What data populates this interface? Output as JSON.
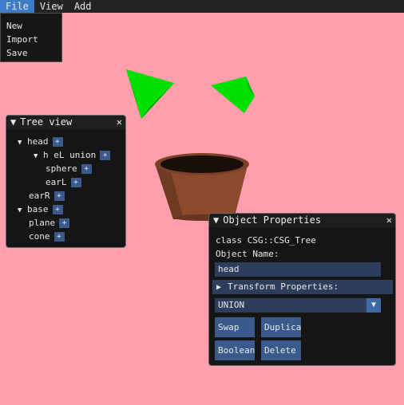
{
  "menubar": {
    "items": [
      "File",
      "View",
      "Add"
    ],
    "file_menu": [
      "New",
      "Import",
      "Save"
    ]
  },
  "tree_view": {
    "title": "Tree view",
    "nodes": [
      {
        "label": "head",
        "expanded": true
      },
      {
        "label": "h eL union",
        "expanded": true
      },
      {
        "label": "sphere"
      },
      {
        "label": "earL"
      },
      {
        "label": "earR"
      },
      {
        "label": "base",
        "expanded": true
      },
      {
        "label": "plane"
      },
      {
        "label": "cone"
      }
    ],
    "plus_label": "+",
    "expand_glyph": "▼",
    "close_glyph": "✕"
  },
  "object_properties": {
    "title": "Object Properties",
    "class_line": "class CSG::CSG_Tree",
    "object_name_label": "Object Name:",
    "object_name_value": "head",
    "transform_header": "Transform Properties:",
    "operation_value": "UNION",
    "buttons": {
      "swap": "Swap",
      "duplicate": "Duplicate",
      "boolean": "Boolean",
      "delete": "Delete"
    }
  },
  "colors": {
    "background": "#ff9fae",
    "ear": "#00e000",
    "pot": "#8b4a2b"
  }
}
